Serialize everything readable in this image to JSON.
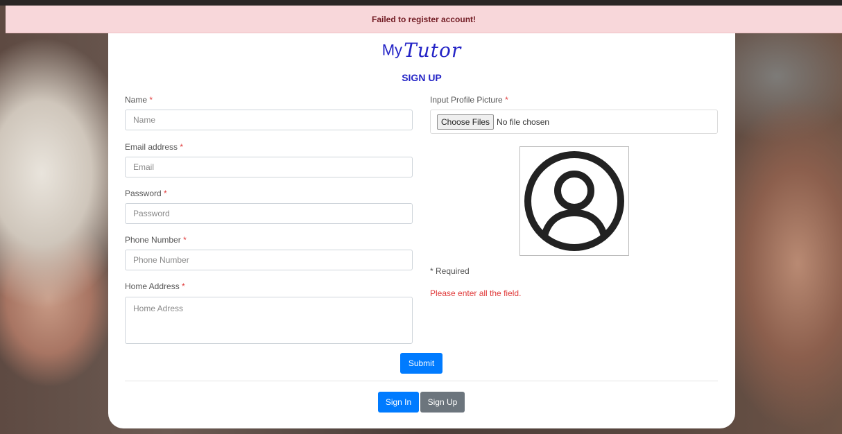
{
  "alert": {
    "message": "Failed to register account!"
  },
  "brand": {
    "prefix": "My",
    "script": "Tutor"
  },
  "form": {
    "title": "SIGN UP",
    "name": {
      "label": "Name",
      "placeholder": "Name"
    },
    "email": {
      "label": "Email address",
      "placeholder": "Email"
    },
    "password": {
      "label": "Password",
      "placeholder": "Password"
    },
    "phone": {
      "label": "Phone Number",
      "placeholder": "Phone Number"
    },
    "address": {
      "label": "Home Address",
      "placeholder": "Home Adress"
    },
    "required_mark": "*",
    "profile_picture": {
      "label": "Input Profile Picture",
      "choose_button": "Choose Files",
      "status": "No file chosen",
      "placeholder_icon": "user-circle-icon"
    },
    "required_note": "* Required",
    "error_note": "Please enter all the field.",
    "submit_label": "Submit"
  },
  "footer": {
    "sign_in_label": "Sign In",
    "sign_up_label": "Sign Up"
  },
  "colors": {
    "brand": "#2424c6",
    "alert_bg": "#f8d7da",
    "alert_text": "#721c24",
    "primary": "#007bff",
    "secondary": "#6c757d",
    "error": "#e03b3b"
  }
}
